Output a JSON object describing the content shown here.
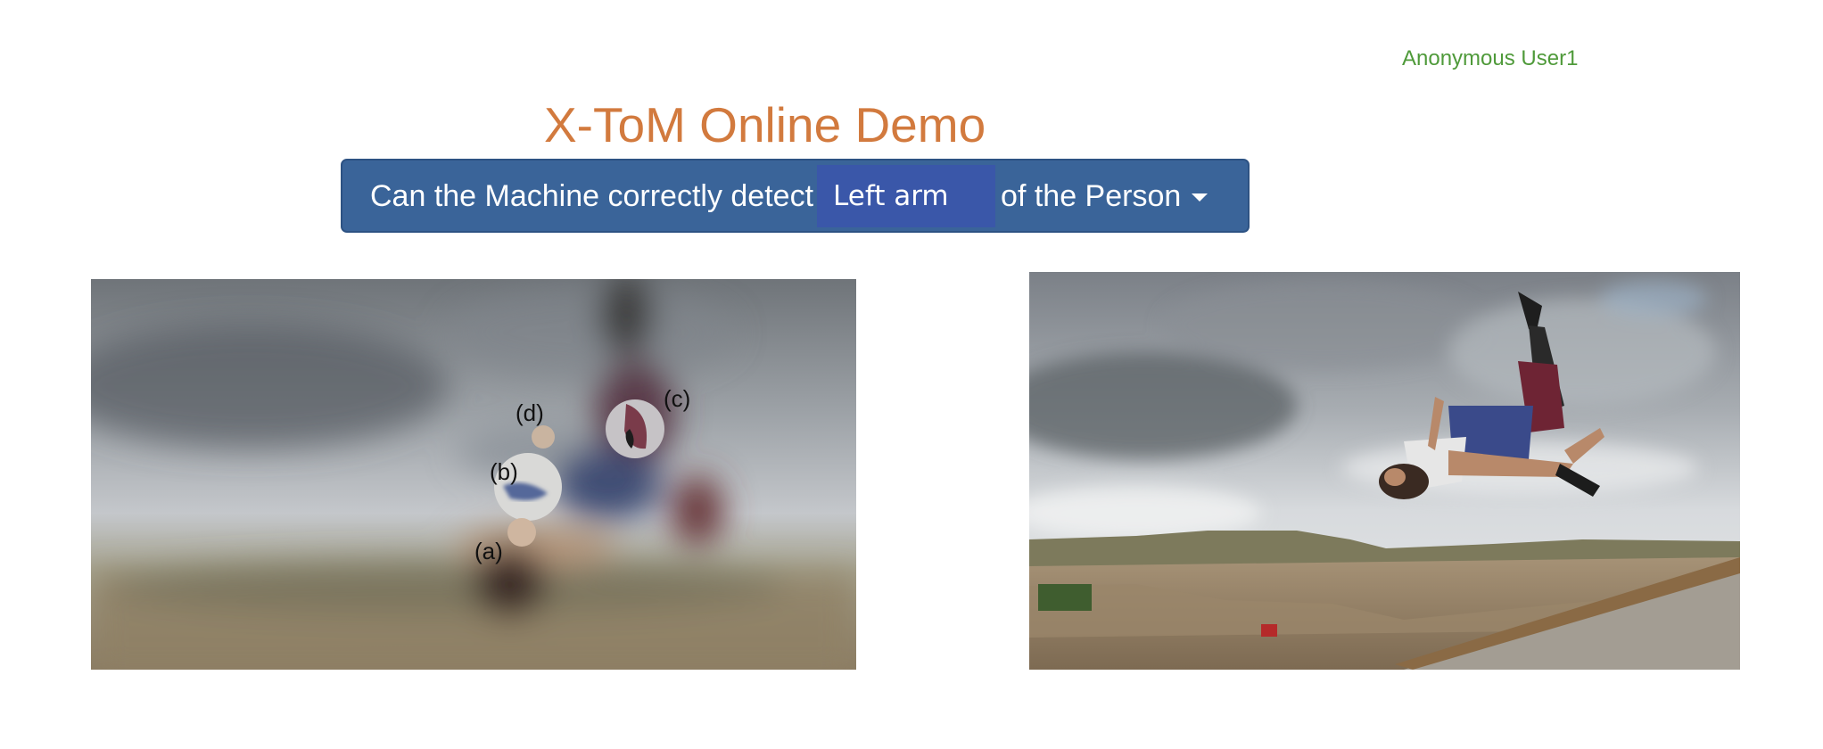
{
  "header": {
    "user_name": "Anonymous User1",
    "title": "X-ToM Online Demo"
  },
  "question": {
    "prefix": "Can the Machine correctly detect",
    "selected_part": "Left arm",
    "suffix": "of the Person"
  },
  "attention_image": {
    "region_labels": [
      "(a)",
      "(b)",
      "(c)",
      "(d)"
    ]
  },
  "colors": {
    "title": "#d27a3e",
    "user": "#4f9a3a",
    "question_bar": "#3a6499",
    "selector": "#3a57a9"
  }
}
